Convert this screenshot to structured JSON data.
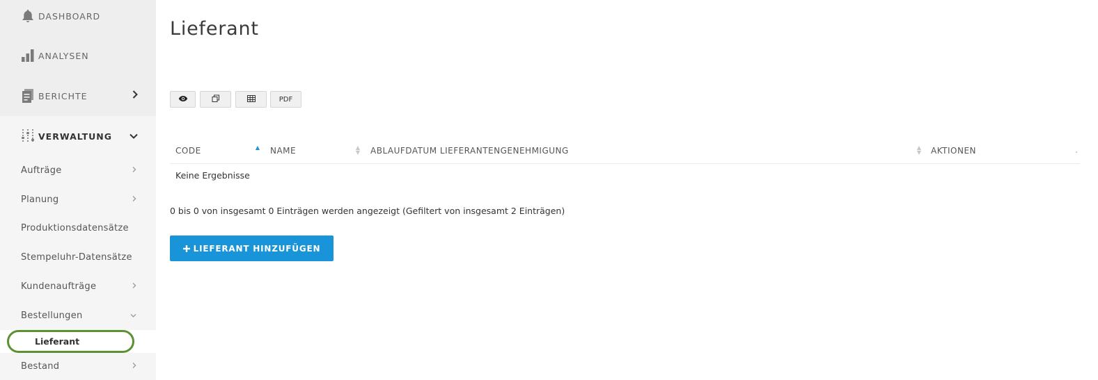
{
  "sidebar": {
    "main_items": [
      {
        "label": "DASHBOARD",
        "icon": "bell-icon"
      },
      {
        "label": "ANALYSEN",
        "icon": "bar-chart-icon"
      },
      {
        "label": "BERICHTE",
        "icon": "reports-icon"
      },
      {
        "label": "VERWALTUNG",
        "icon": "sliders-icon"
      }
    ],
    "sub_items": [
      {
        "label": "Aufträge"
      },
      {
        "label": "Planung"
      },
      {
        "label": "Produktionsdatensätze"
      },
      {
        "label": "Stempeluhr-Datensätze"
      },
      {
        "label": "Kundenaufträge"
      },
      {
        "label": "Bestellungen"
      },
      {
        "label": "Lieferant"
      },
      {
        "label": "Bestand"
      }
    ]
  },
  "main": {
    "title": "Lieferant",
    "toolbar": {
      "pdf_label": "PDF"
    },
    "table": {
      "columns": [
        "CODE",
        "NAME",
        "ABLAUFDATUM LIEFERANTENGENEHMIGUNG",
        "AKTIONEN"
      ],
      "empty_text": "Keine Ergebnisse"
    },
    "info_text": "0 bis 0 von insgesamt 0 Einträgen werden angezeigt (Gefiltert von insgesamt 2 Einträgen)",
    "add_button_label": "LIEFERANT HINZUFÜGEN"
  },
  "colors": {
    "accent": "#1a94d8",
    "highlight_ring": "#5b9132",
    "sidebar_bg": "#f5f5f5"
  }
}
